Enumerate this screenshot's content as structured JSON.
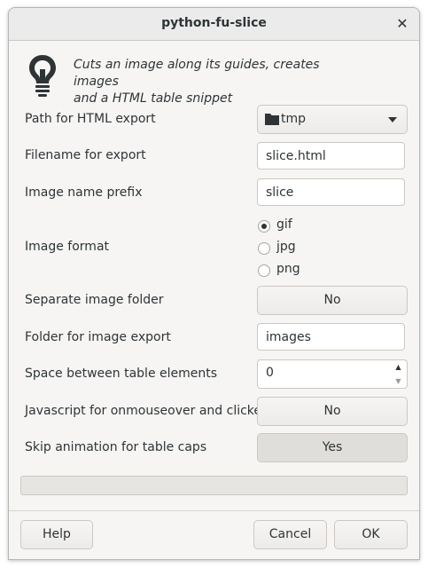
{
  "window": {
    "title": "python-fu-slice",
    "close_glyph": "✕"
  },
  "header": {
    "icon": "lightbulb-icon",
    "description_line1": "Cuts an image along its guides, creates images",
    "description_line2": "and a HTML table snippet"
  },
  "fields": {
    "html_path": {
      "label": "Path for HTML export",
      "value": "tmp",
      "icon": "folder-icon"
    },
    "filename": {
      "label": "Filename for export",
      "value": "slice.html"
    },
    "prefix": {
      "label": "Image name prefix",
      "value": "slice"
    },
    "format": {
      "label": "Image format",
      "options": [
        "gif",
        "jpg",
        "png"
      ],
      "selected": "gif"
    },
    "separate_folder": {
      "label": "Separate image folder",
      "value": "No"
    },
    "image_folder": {
      "label": "Folder for image export",
      "value": "images"
    },
    "spacing": {
      "label": "Space between table elements",
      "value": "0"
    },
    "javascript": {
      "label": "Javascript for onmouseover and clicked",
      "value": "No"
    },
    "skip_caps": {
      "label": "Skip animation for table caps",
      "value": "Yes"
    }
  },
  "progress": {
    "value": 0
  },
  "actions": {
    "help": "Help",
    "cancel": "Cancel",
    "ok": "OK"
  },
  "colors": {
    "dialog_bg": "#f6f5f4",
    "text": "#2e3436",
    "border": "#cdc7c2",
    "accent": "#3584e4"
  }
}
